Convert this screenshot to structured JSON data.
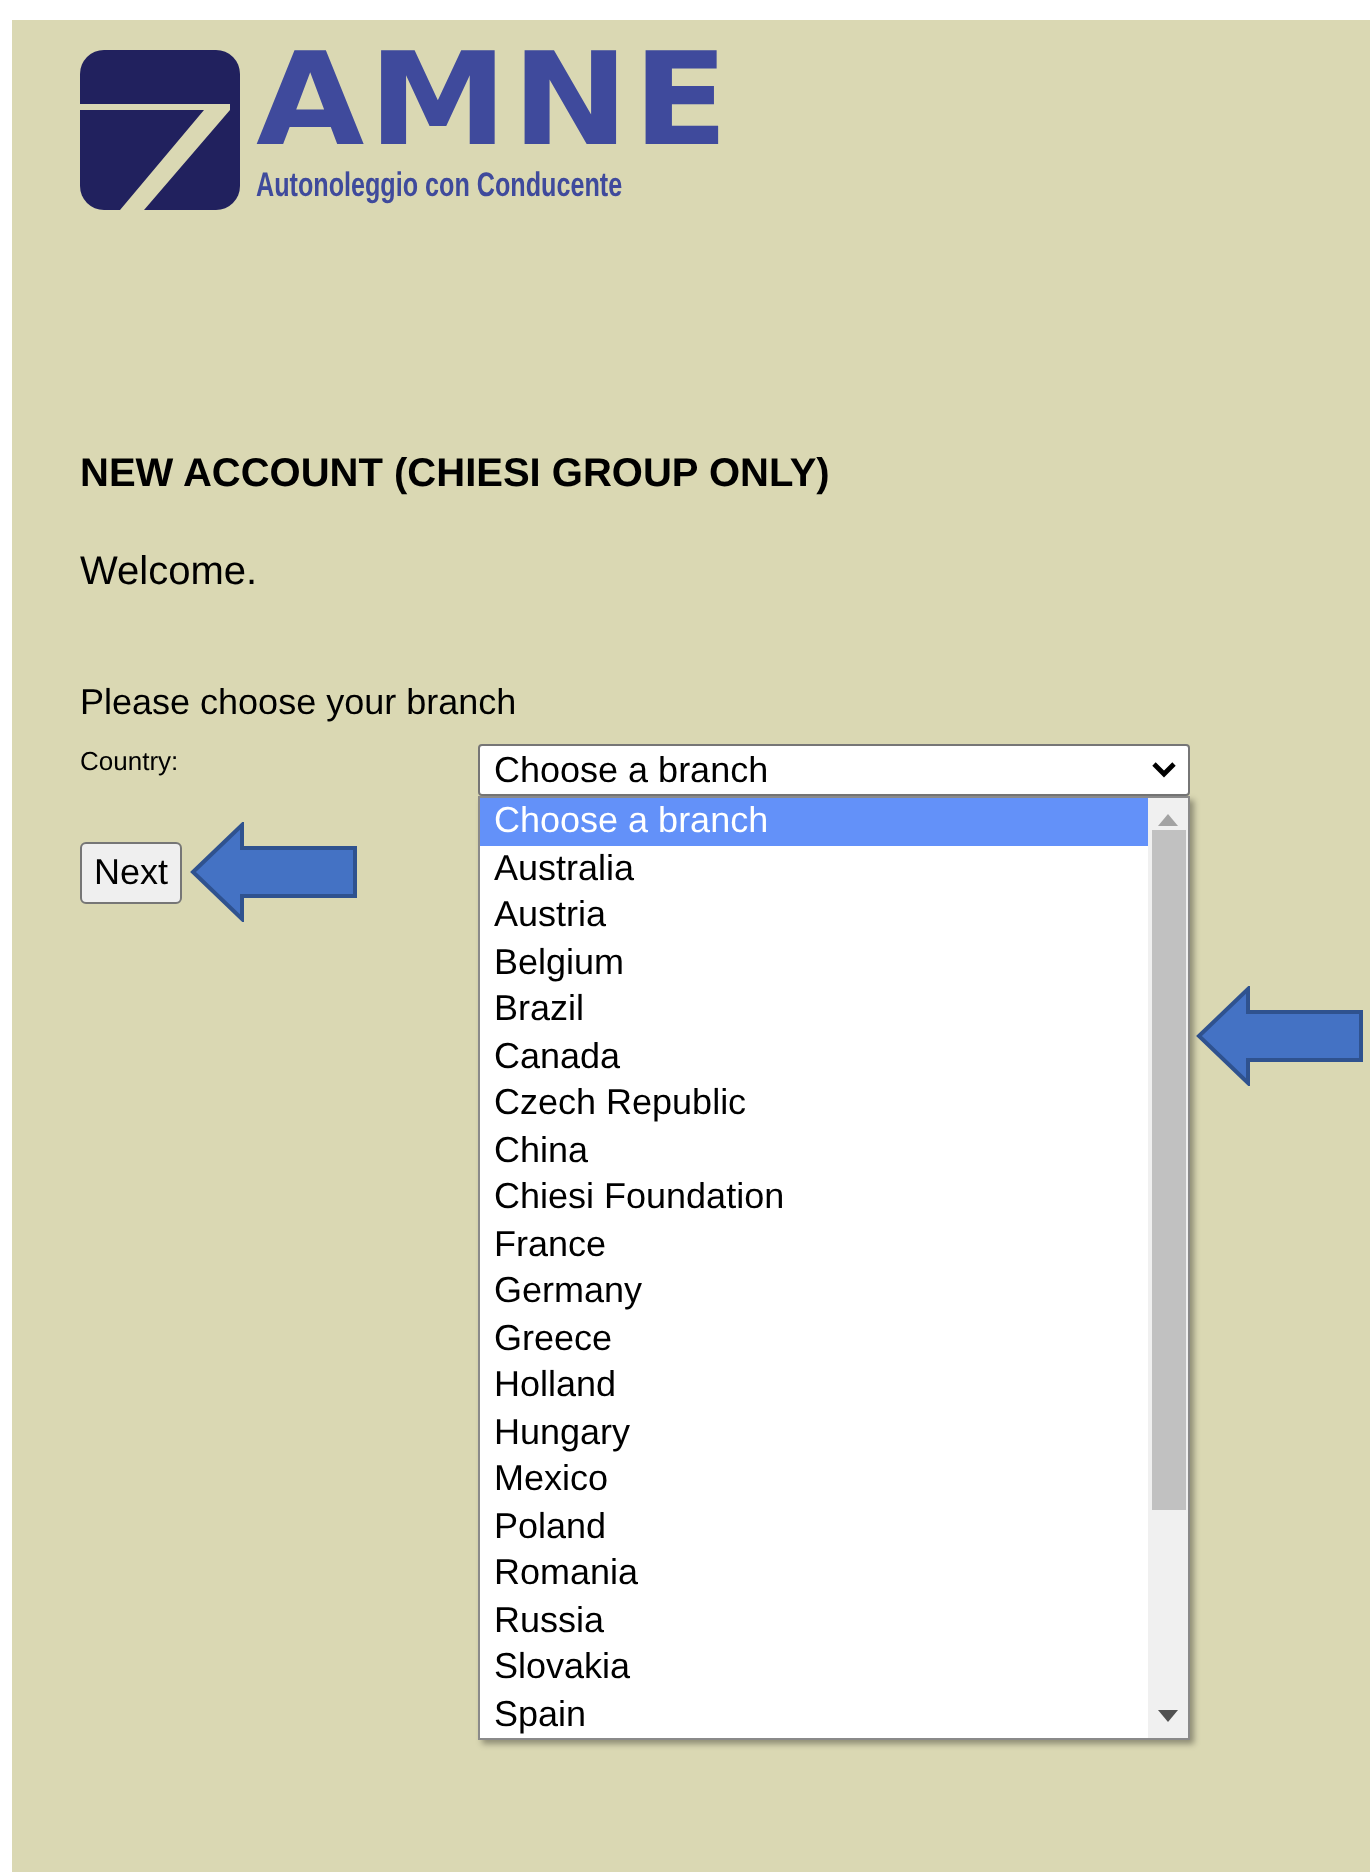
{
  "logo": {
    "name": "AMNE",
    "tagline": "Autonoleggio con Conducente"
  },
  "heading": "NEW ACCOUNT (CHIESI GROUP ONLY)",
  "welcome": "Welcome.",
  "instruction": "Please choose your branch",
  "country_field": {
    "label": "Country:",
    "value": "Choose a branch",
    "expanded": true,
    "options": [
      {
        "label": "Choose a branch",
        "selected": true
      },
      {
        "label": "Australia",
        "selected": false
      },
      {
        "label": "Austria",
        "selected": false
      },
      {
        "label": "Belgium",
        "selected": false
      },
      {
        "label": "Brazil",
        "selected": false
      },
      {
        "label": "Canada",
        "selected": false
      },
      {
        "label": "Czech Republic",
        "selected": false
      },
      {
        "label": "China",
        "selected": false
      },
      {
        "label": "Chiesi Foundation",
        "selected": false
      },
      {
        "label": "France",
        "selected": false
      },
      {
        "label": "Germany",
        "selected": false
      },
      {
        "label": "Greece",
        "selected": false
      },
      {
        "label": "Holland",
        "selected": false
      },
      {
        "label": "Hungary",
        "selected": false
      },
      {
        "label": "Mexico",
        "selected": false
      },
      {
        "label": "Poland",
        "selected": false
      },
      {
        "label": "Romania",
        "selected": false
      },
      {
        "label": "Russia",
        "selected": false
      },
      {
        "label": "Slovakia",
        "selected": false
      },
      {
        "label": "Spain",
        "selected": false
      }
    ]
  },
  "buttons": [
    "Next"
  ]
}
